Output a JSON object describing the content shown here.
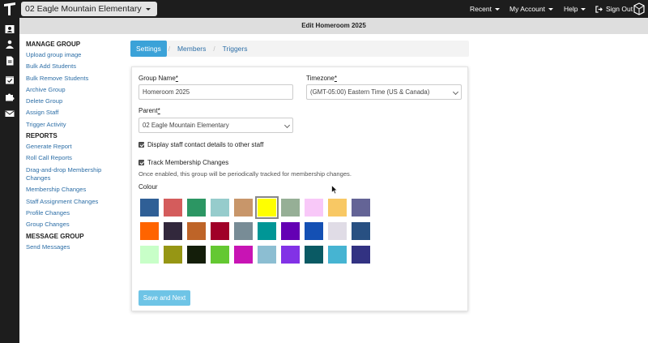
{
  "header": {
    "school_name": "02 Eagle Mountain Elementary",
    "nav": [
      {
        "label": "Recent",
        "icon": "caret-down-icon"
      },
      {
        "label": "My Account",
        "icon": "caret-down-icon"
      },
      {
        "label": "Help",
        "icon": "caret-down-icon"
      },
      {
        "label": "Sign Out",
        "icon": "sign-out-icon"
      }
    ]
  },
  "page": {
    "title": "Edit Homeroom 2025"
  },
  "sidebar": {
    "manage_group": {
      "heading": "MANAGE GROUP",
      "items": [
        "Upload group image",
        "Bulk Add Students",
        "Bulk Remove Students",
        "Archive Group",
        "Delete Group",
        "Assign Staff",
        "Trigger Activity"
      ]
    },
    "reports": {
      "heading": "REPORTS",
      "items": [
        "Generate Report",
        "Roll Call Reports",
        "Drag-and-drop Membership",
        "Changes",
        "Membership Changes",
        "Staff Assignment Changes",
        "Profile Changes",
        "Group Changes"
      ]
    },
    "message_group": {
      "heading": "MESSAGE GROUP",
      "items": [
        "Send Messages"
      ]
    }
  },
  "tabs": [
    {
      "label": "Settings",
      "active": true
    },
    {
      "label": "Members",
      "active": false
    },
    {
      "label": "Triggers",
      "active": false
    }
  ],
  "form": {
    "group_name_label": "Group Name",
    "group_name_value": "Homeroom 2025",
    "timezone_label": "Timezone",
    "timezone_value": "(GMT-05:00) Eastern Time (US & Canada)",
    "parent_label": "Parent",
    "parent_value": "02 Eagle Mountain Elementary",
    "required_mark": "*",
    "display_contact_label": "Display staff contact details to other staff",
    "display_contact_checked": true,
    "track_membership_label": "Track Membership Changes",
    "track_membership_checked": true,
    "track_hint": "Once enabled, this group will be periodically tracked for membership changes.",
    "colour_label": "Colour",
    "selected_colour": "#ffff00",
    "colours": [
      [
        "#2f5f96",
        "#d45c5c",
        "#2c9663",
        "#96cccc",
        "#c8966a",
        "#ffff00",
        "#96af96",
        "#f8c8f8",
        "#f8c864",
        "#646496"
      ],
      [
        "#ff6400",
        "#32283c",
        "#be6428",
        "#a00028",
        "#788c96",
        "#009696",
        "#6400b4",
        "#1450b4",
        "#e0dce6",
        "#285082"
      ],
      [
        "#c8ffc8",
        "#969614",
        "#141e0a",
        "#64c832",
        "#c814b4",
        "#8cbed2",
        "#8232e6",
        "#0a5a64",
        "#46b4d2",
        "#323282"
      ]
    ],
    "save_button": "Save and Next"
  },
  "colors": {
    "topbar": "#1d1d1d",
    "link": "#2e6fa7",
    "tab_active": "#3ba2d8",
    "button": "#6ec4e6"
  }
}
